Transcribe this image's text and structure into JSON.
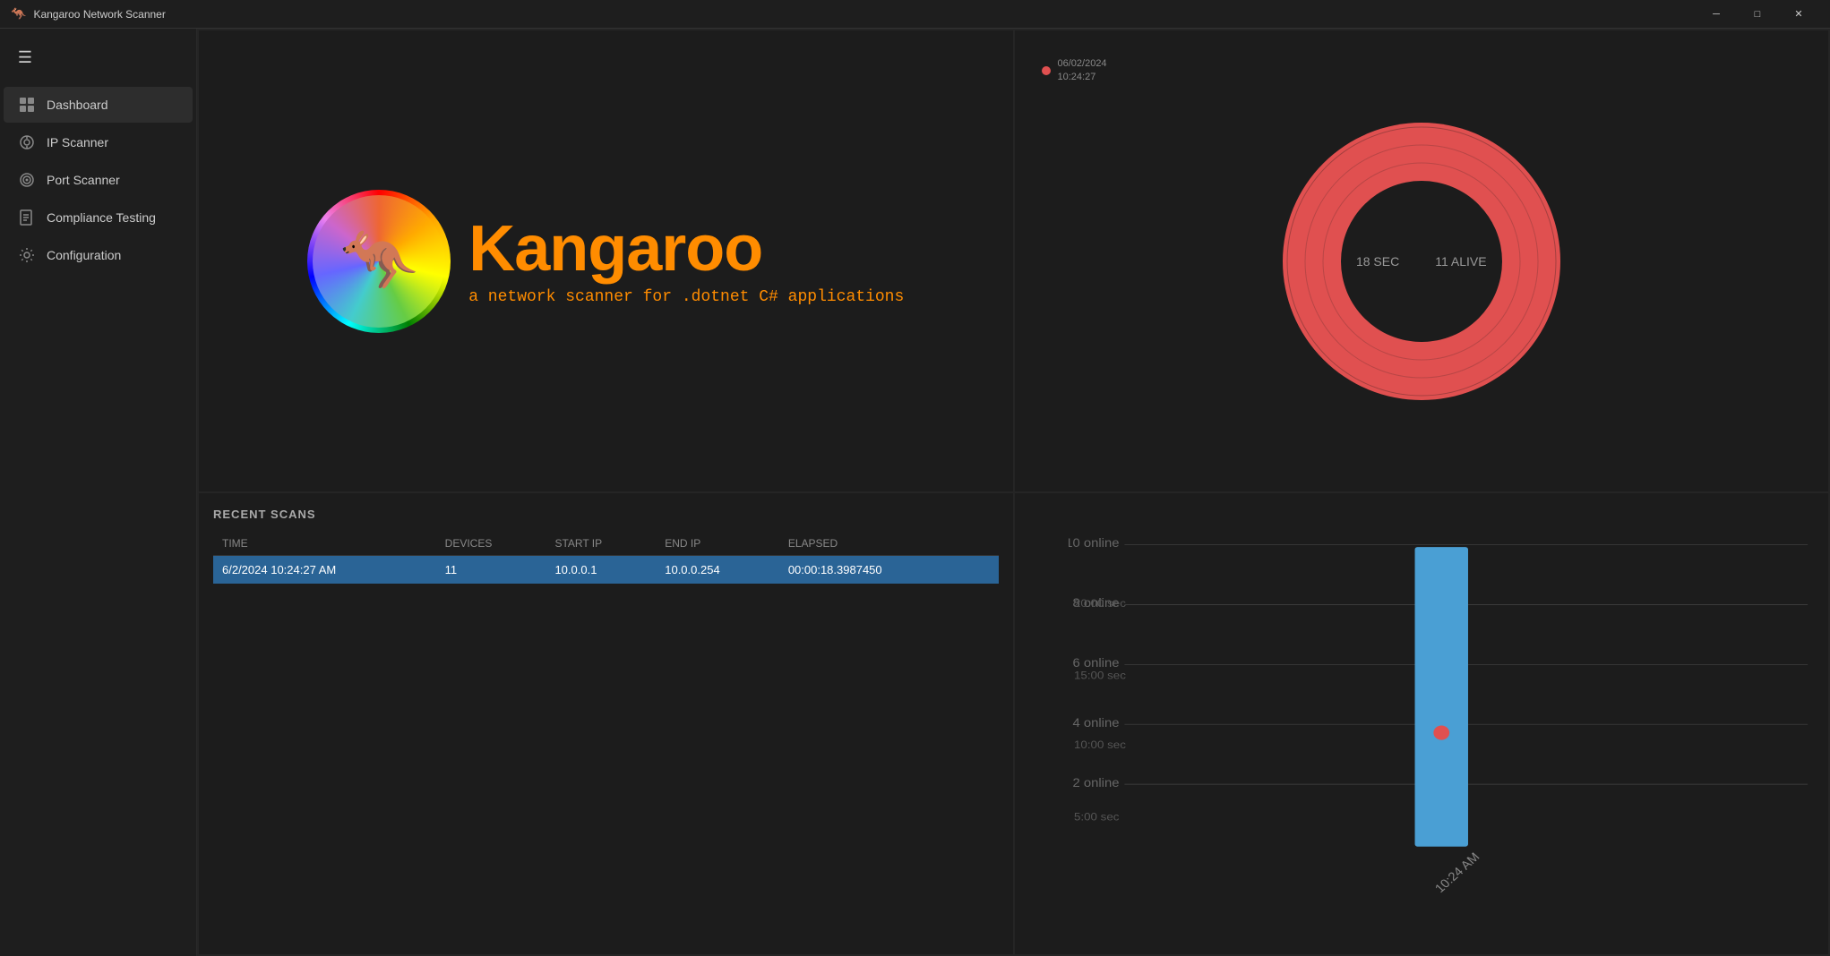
{
  "app": {
    "title": "Kangaroo Network Scanner",
    "icon": "🦘"
  },
  "titlebar": {
    "minimize_label": "─",
    "restore_label": "□",
    "close_label": "✕"
  },
  "sidebar": {
    "hamburger": "☰",
    "items": [
      {
        "id": "dashboard",
        "label": "Dashboard",
        "icon": "⊞",
        "active": true
      },
      {
        "id": "ip-scanner",
        "label": "IP Scanner",
        "icon": "⊙"
      },
      {
        "id": "port-scanner",
        "label": "Port Scanner",
        "icon": "⊚"
      },
      {
        "id": "compliance-testing",
        "label": "Compliance Testing",
        "icon": "✔"
      },
      {
        "id": "configuration",
        "label": "Configuration",
        "icon": "⚙"
      }
    ]
  },
  "logo_panel": {
    "title": "Kangaroo",
    "subtitle": "a network scanner for .dotnet C# applications",
    "emoji": "🦘"
  },
  "donut_panel": {
    "status_date": "06/02/2024",
    "status_time": "10:24:27",
    "sec_label": "18 SEC",
    "alive_label": "11 ALIVE",
    "total_value": 11,
    "fill_color": "#e05050",
    "bg_color": "#2a1a1a"
  },
  "recent_scans": {
    "title": "RECENT SCANS",
    "columns": [
      "TIME",
      "DEVICES",
      "START IP",
      "END IP",
      "ELAPSED"
    ],
    "rows": [
      {
        "time": "6/2/2024 10:24:27 AM",
        "devices": "11",
        "start_ip": "10.0.0.1",
        "end_ip": "10.0.0.254",
        "elapsed": "00:00:18.3987450",
        "selected": true
      }
    ]
  },
  "bar_chart": {
    "y_labels": [
      "10 online",
      "8 online",
      "6 online",
      "4 online",
      "2 online"
    ],
    "x_labels": [
      "10:24 AM"
    ],
    "time_labels": [
      "20:00 sec",
      "15:00 sec",
      "10:00 sec",
      "5:00 sec"
    ],
    "bars": [
      {
        "x": 65,
        "value": 11,
        "height_pct": 85,
        "color": "#4a9fd4"
      }
    ],
    "highlight_dot": {
      "color": "#e05050"
    }
  }
}
